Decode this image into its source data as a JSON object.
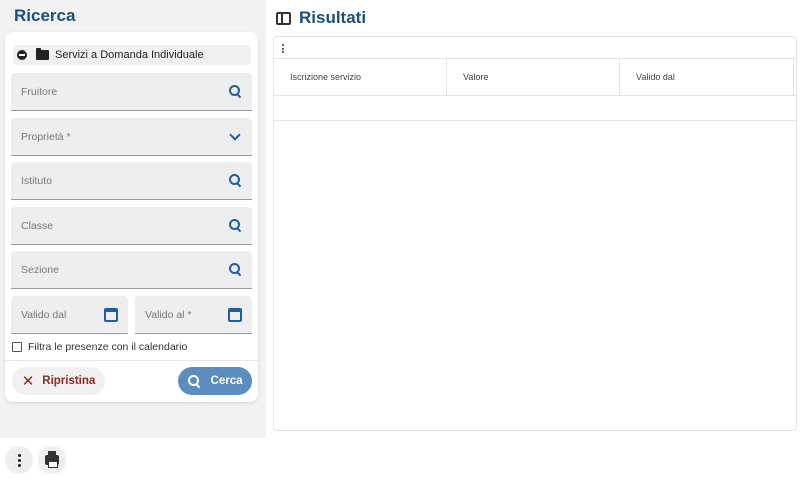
{
  "left": {
    "title": "Ricerca",
    "category": "Servizi a Domanda Individuale",
    "fields": {
      "fruitore": "Fruitore",
      "proprieta": "Proprietà *",
      "istituto": "Istituto",
      "classe": "Classe",
      "sezione": "Sezione",
      "valido_dal": "Valido dal",
      "valido_al": "Valido al *"
    },
    "checkbox_label": "Filtra le presenze con il calendario",
    "reset_label": "Ripristina",
    "search_label": "Cerca"
  },
  "results": {
    "title": "Risultati",
    "columns": [
      "Iscrizione servizio",
      "Valore",
      "Valido dal"
    ]
  },
  "colors": {
    "title": "#1c4f7c",
    "accent": "#1e5fa3",
    "search_button": "#5b8dc0",
    "reset_text": "#8a2a2a"
  },
  "icons": [
    "collapse-icon",
    "folder-icon",
    "search-icon",
    "chevron-down-icon",
    "calendar-icon",
    "close-icon",
    "sidebar-toggle-icon",
    "more-vertical-icon",
    "print-icon"
  ]
}
